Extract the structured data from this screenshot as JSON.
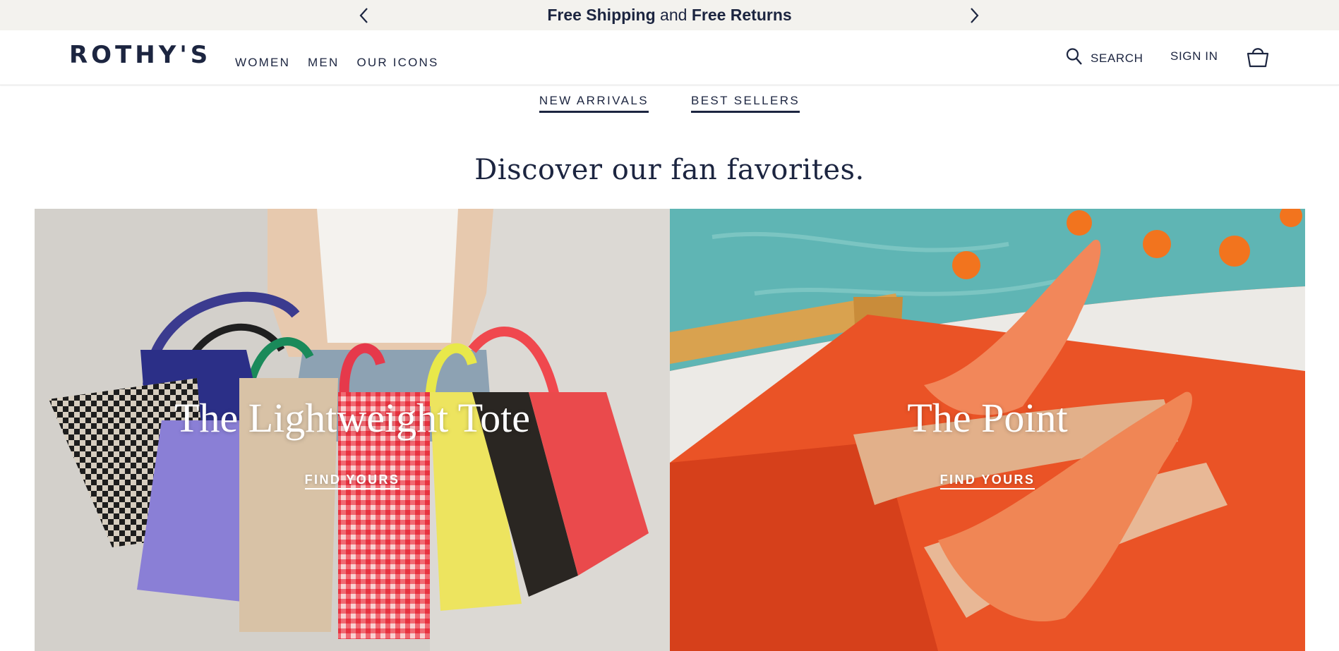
{
  "announcement": {
    "part1": "Free Shipping",
    "part2": " and ",
    "part3": "Free Returns",
    "prev_icon": "chevron-left-icon",
    "next_icon": "chevron-right-icon"
  },
  "header": {
    "logo": "ROTHY'S",
    "nav": [
      "WOMEN",
      "MEN",
      "OUR ICONS"
    ],
    "search_label": "SEARCH",
    "signin_label": "SIGN IN",
    "search_icon": "search-icon",
    "cart_icon": "shopping-basket-icon"
  },
  "subnav": [
    "NEW ARRIVALS",
    "BEST SELLERS"
  ],
  "section_heading": "Discover our fan favorites.",
  "tiles": [
    {
      "title": "The Lightweight Tote",
      "cta": "FIND YOURS"
    },
    {
      "title": "The Point",
      "cta": "FIND YOURS"
    }
  ],
  "colors": {
    "brand_navy": "#1c2540",
    "announce_bg": "#f3f2ee",
    "point_orange": "#e6461e",
    "pool_teal": "#5fb5b4"
  }
}
